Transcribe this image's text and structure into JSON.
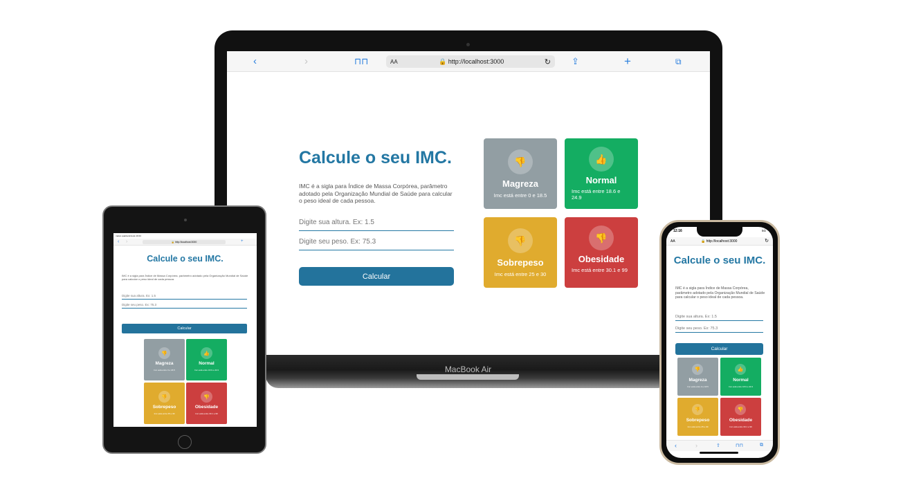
{
  "app": {
    "title": "Calcule o seu IMC.",
    "description": "IMC é a sigla para Índice de Massa Corpórea, parâmetro adotado pela Organização Mundial de Saúde para calcular o peso ideal de cada pessoa.",
    "height_placeholder": "Digite sua altura. Ex: 1.5",
    "weight_placeholder": "Digite seu peso. Ex: 75.3",
    "button_label": "Calcular",
    "cards": [
      {
        "name": "Magreza",
        "range": "Imc está entre 0 e 18.5",
        "icon": "thumbs-down-icon",
        "color": "#929ea3"
      },
      {
        "name": "Normal",
        "range": "Imc está entre 18.6 e 24.9",
        "icon": "thumbs-up-icon",
        "color": "#14ad62"
      },
      {
        "name": "Sobrepeso",
        "range": "Imc está entre 25 e 30",
        "icon": "thumbs-down-icon",
        "color": "#e0ab2e"
      },
      {
        "name": "Obesidade",
        "range": "Imc está entre 30.1 e 99",
        "icon": "thumbs-down-icon",
        "color": "#cc3f3f"
      }
    ]
  },
  "browser": {
    "url": "http://localhost:3000",
    "aa_label": "AA"
  },
  "laptop": {
    "brand": "MacBook Air"
  },
  "tablet": {
    "status": "março quarta-feira às 10:24"
  },
  "phone": {
    "time": "12:16",
    "signal": "5G"
  }
}
